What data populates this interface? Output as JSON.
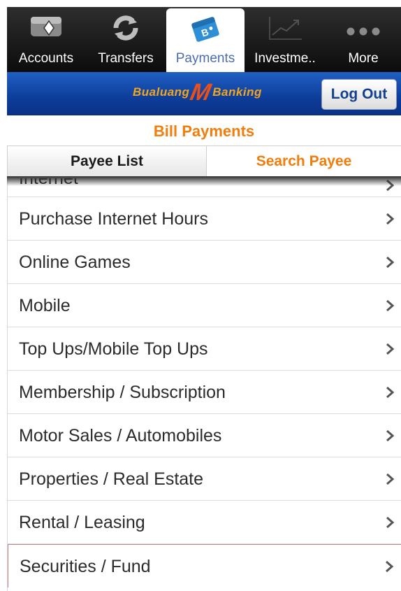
{
  "tabs": [
    {
      "label": "Accounts",
      "icon": "wallet-icon"
    },
    {
      "label": "Transfers",
      "icon": "refresh-icon"
    },
    {
      "label": "Payments",
      "icon": "bill-card-icon"
    },
    {
      "label": "Investme..",
      "icon": "chart-line-icon"
    },
    {
      "label": "More",
      "icon": "more-dots-icon"
    }
  ],
  "header": {
    "logo_left": "Bualuang",
    "logo_m": "M",
    "logo_right": "Banking",
    "logout_label": "Log Out"
  },
  "page": {
    "title": "Bill Payments"
  },
  "segments": {
    "left_label": "Payee List",
    "right_label": "Search Payee"
  },
  "list": {
    "items": [
      {
        "label": "Internet"
      },
      {
        "label": "Purchase Internet Hours"
      },
      {
        "label": "Online Games"
      },
      {
        "label": "Mobile"
      },
      {
        "label": "Top Ups/Mobile Top Ups"
      },
      {
        "label": "Membership / Subscription"
      },
      {
        "label": "Motor Sales / Automobiles"
      },
      {
        "label": "Properties / Real Estate"
      },
      {
        "label": "Rental / Leasing"
      },
      {
        "label": "Securities / Fund"
      }
    ]
  },
  "colors": {
    "accent_orange": "#f07d0c",
    "header_blue": "#0d3d99",
    "active_tab_text": "#4a6db0"
  }
}
